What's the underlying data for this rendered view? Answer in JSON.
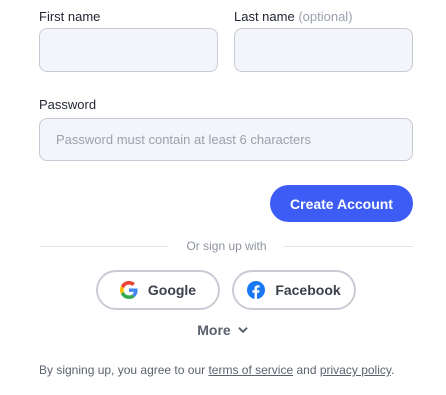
{
  "form": {
    "first_name_label": "First name",
    "last_name_label": "Last name",
    "last_name_optional": "(optional)",
    "first_name_value": "",
    "last_name_value": "",
    "password_label": "Password",
    "password_placeholder": "Password must contain at least 6 characters",
    "password_value": ""
  },
  "primary": {
    "create_account_label": "Create Account"
  },
  "divider": {
    "text": "Or sign up with"
  },
  "social": [
    {
      "label": "Google",
      "icon": "google-icon"
    },
    {
      "label": "Facebook",
      "icon": "facebook-icon"
    }
  ],
  "more": {
    "label": "More",
    "icon": "chevron-down-icon"
  },
  "terms": {
    "prefix": "By signing up, you agree to our ",
    "tos": "terms of service",
    "middle": " and ",
    "privacy": "privacy policy",
    "suffix": "."
  },
  "colors": {
    "primary": "#3d5cf5",
    "field_bg": "#f4f5fa",
    "field_border": "#c7cbd5",
    "facebook": "#1877f2"
  }
}
